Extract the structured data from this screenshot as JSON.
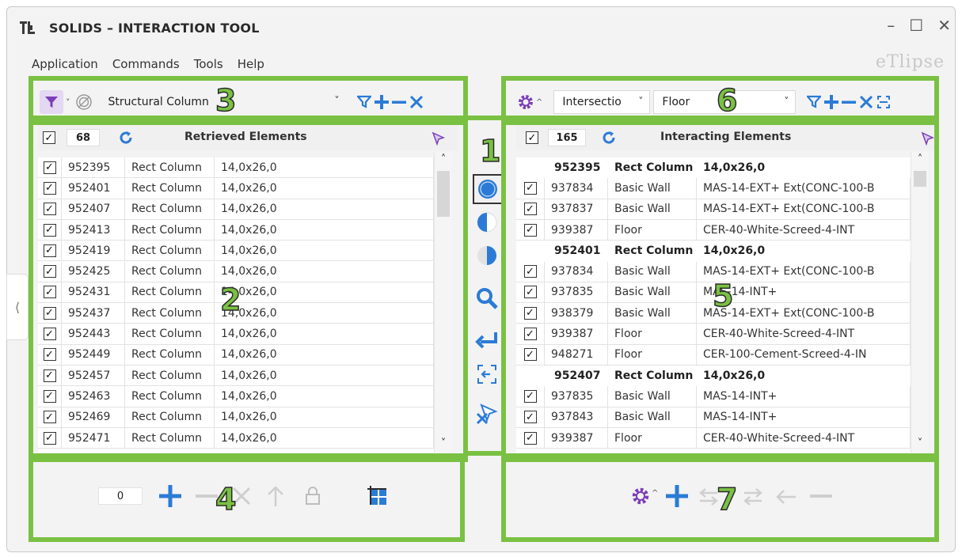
{
  "window": {
    "title": "SOLIDS – INTERACTION TOOL",
    "brand": "eTlipse",
    "controls": {
      "minimize": "–",
      "maximize": "☐",
      "close": "✕"
    }
  },
  "menu": [
    "Application",
    "Commands",
    "Tools",
    "Help"
  ],
  "callouts": [
    "1",
    "2",
    "3",
    "4",
    "5",
    "6",
    "7"
  ],
  "left": {
    "toolbar": {
      "category": "Structural Column"
    },
    "header": {
      "count": "68",
      "title": "Retrieved Elements"
    },
    "rows": [
      {
        "id": "952395",
        "type": "Rect Column",
        "size": "14,0x26,0"
      },
      {
        "id": "952401",
        "type": "Rect Column",
        "size": "14,0x26,0"
      },
      {
        "id": "952407",
        "type": "Rect Column",
        "size": "14,0x26,0"
      },
      {
        "id": "952413",
        "type": "Rect Column",
        "size": "14,0x26,0"
      },
      {
        "id": "952419",
        "type": "Rect Column",
        "size": "14,0x26,0"
      },
      {
        "id": "952425",
        "type": "Rect Column",
        "size": "14,0x26,0"
      },
      {
        "id": "952431",
        "type": "Rect Column",
        "size": "14,0x26,0"
      },
      {
        "id": "952437",
        "type": "Rect Column",
        "size": "14,0x26,0"
      },
      {
        "id": "952443",
        "type": "Rect Column",
        "size": "14,0x26,0"
      },
      {
        "id": "952449",
        "type": "Rect Column",
        "size": "14,0x26,0"
      },
      {
        "id": "952457",
        "type": "Rect Column",
        "size": "14,0x26,0"
      },
      {
        "id": "952463",
        "type": "Rect Column",
        "size": "14,0x26,0"
      },
      {
        "id": "952469",
        "type": "Rect Column",
        "size": "14,0x26,0"
      },
      {
        "id": "952471",
        "type": "Rect Column",
        "size": "14,0x26,0"
      }
    ],
    "bottom": {
      "value": "0"
    }
  },
  "right": {
    "toolbar": {
      "mode": "Intersectio",
      "category": "Floor"
    },
    "header": {
      "count": "165",
      "title": "Interacting Elements"
    },
    "rows": [
      {
        "group": true,
        "id": "952395",
        "type": "Rect Column",
        "info": "14,0x26,0"
      },
      {
        "id": "937834",
        "type": "Basic Wall",
        "info": "MAS-14-EXT+ Ext(CONC-100-B"
      },
      {
        "id": "937837",
        "type": "Basic Wall",
        "info": "MAS-14-EXT+ Ext(CONC-100-B"
      },
      {
        "id": "939387",
        "type": "Floor",
        "info": "CER-40-White-Screed-4-INT"
      },
      {
        "group": true,
        "id": "952401",
        "type": "Rect Column",
        "info": "14,0x26,0"
      },
      {
        "id": "937834",
        "type": "Basic Wall",
        "info": "MAS-14-EXT+ Ext(CONC-100-B"
      },
      {
        "id": "937835",
        "type": "Basic Wall",
        "info": "MAS-14-INT+"
      },
      {
        "id": "938379",
        "type": "Basic Wall",
        "info": "MAS-14-EXT+ Ext(CONC-100-B"
      },
      {
        "id": "939387",
        "type": "Floor",
        "info": "CER-40-White-Screed-4-INT"
      },
      {
        "id": "948271",
        "type": "Floor",
        "info": "CER-100-Cement-Screed-4-IN"
      },
      {
        "group": true,
        "id": "952407",
        "type": "Rect Column",
        "info": "14,0x26,0"
      },
      {
        "id": "937835",
        "type": "Basic Wall",
        "info": "MAS-14-INT+"
      },
      {
        "id": "937843",
        "type": "Basic Wall",
        "info": "MAS-14-INT+"
      },
      {
        "id": "939387",
        "type": "Floor",
        "info": "CER-40-White-Screed-4-INT"
      }
    ]
  },
  "colors": {
    "accent_blue": "#2b7bd6",
    "accent_purple": "#7b3fb8",
    "callout_green": "#7ac143"
  }
}
